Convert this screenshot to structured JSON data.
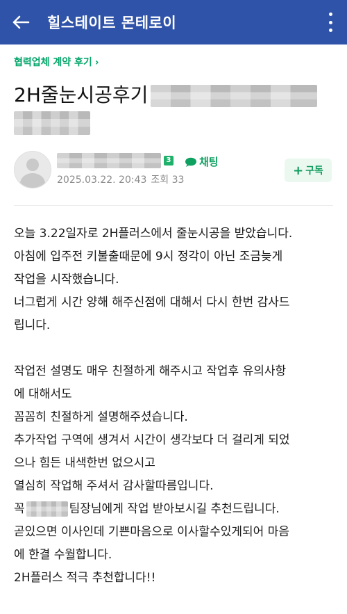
{
  "appbar": {
    "title": "힐스테이트 몬테로이"
  },
  "post": {
    "category": "협력업체 계약 후기",
    "category_chevron": "›",
    "title": "2H줄눈시공후기",
    "author": {
      "level": "3",
      "chat_label": "채팅",
      "date": "2025.03.22. 20:43",
      "views": "조회 33"
    },
    "follow_label": "구독",
    "body": {
      "p1": "오늘 3.22일자로 2H플러스에서 줄눈시공을 받았습니다.",
      "p2": "아침에 입주전 키불출때문에 9시 정각이 아닌 조금늦게",
      "p3": "작업을 시작했습니다.",
      "p4": "너그럽게 시간 양해 해주신점에 대해서 다시 한번 감사드",
      "p5": "립니다.",
      "p6": "작업전 설명도 매우 친절하게 해주시고 작업후 유의사항",
      "p7": "에 대해서도",
      "p8": "꼼꼼히 친절하게 설명해주셨습니다.",
      "p9": "추가작업 구역에 생겨서 시간이 생각보다 더 걸리게 되었",
      "p10": "으나 힘든 내색한번 없으시고",
      "p11": "열심히 작업해 주셔서 감사할따름입니다.",
      "p12_a": "꼭",
      "p12_b": "팀장님에게 작업 받아보시길 추천드립니다.",
      "p13": "곧있으면 이사인데 기쁜마음으로 이사할수있게되어 마음",
      "p14": "에 한결 수월합니다.",
      "p15": "2H플러스 적극 추천합니다!!"
    }
  },
  "colors": {
    "appbar": "#2f53a8",
    "accent_green": "#03a56a"
  }
}
